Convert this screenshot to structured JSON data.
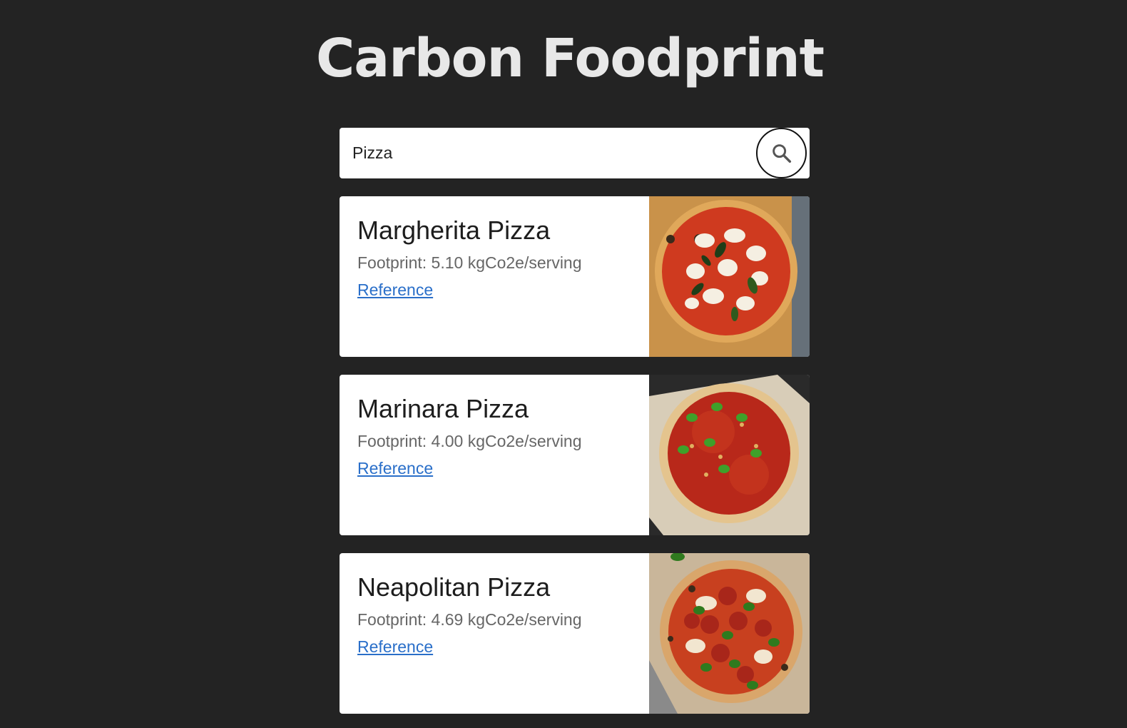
{
  "header": {
    "title": "Carbon Foodprint"
  },
  "search": {
    "value": "Pizza",
    "button_icon": "search-icon"
  },
  "results": [
    {
      "name": "Margherita Pizza",
      "footprint": "Footprint: 5.10 kgCo2e/serving",
      "link_label": "Reference"
    },
    {
      "name": "Marinara Pizza",
      "footprint": "Footprint: 4.00 kgCo2e/serving",
      "link_label": "Reference"
    },
    {
      "name": "Neapolitan Pizza",
      "footprint": "Footprint: 4.69 kgCo2e/serving",
      "link_label": "Reference"
    }
  ],
  "colors": {
    "background": "#232323",
    "title": "#e8e8e8",
    "link": "#2a6fc9"
  }
}
